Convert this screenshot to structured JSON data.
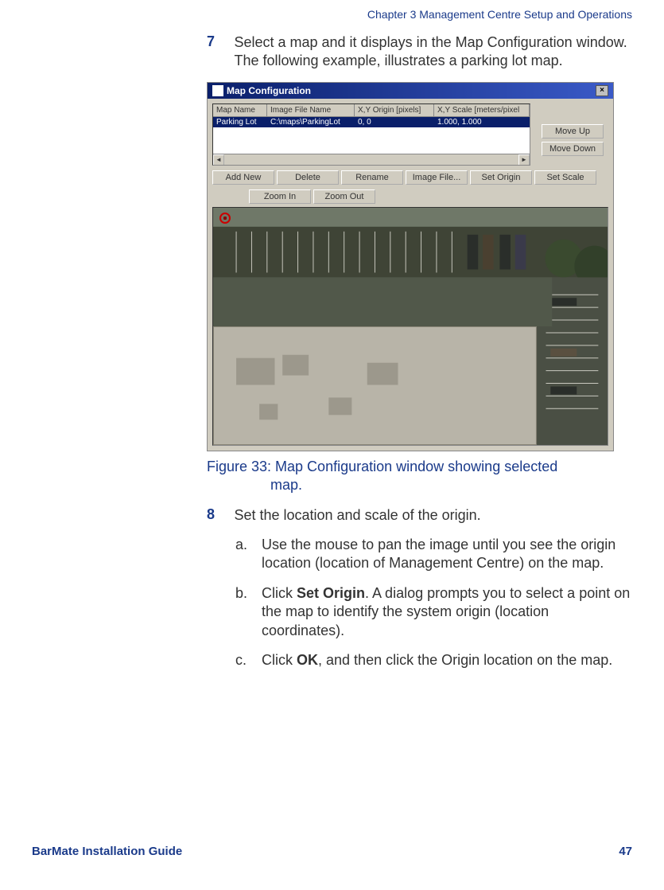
{
  "chapter_header": "Chapter 3 Management Centre Setup and Operations",
  "step7": {
    "num": "7",
    "text": "Select a map and it displays in the Map Configuration window. The following example, illustrates a parking lot map."
  },
  "screenshot": {
    "title": "Map Configuration",
    "close": "×",
    "headers": {
      "map_name": "Map Name",
      "image_file": "Image File Name",
      "origin": "X,Y Origin [pixels]",
      "scale": "X,Y Scale [meters/pixel"
    },
    "row": {
      "map_name": "Parking Lot",
      "image_file": "C:\\maps\\ParkingLot",
      "origin": "0, 0",
      "scale": "1.000, 1.000"
    },
    "buttons": {
      "move_up": "Move Up",
      "move_down": "Move Down",
      "add_new": "Add New",
      "delete": "Delete",
      "rename": "Rename",
      "image_file": "Image File...",
      "set_origin": "Set Origin",
      "set_scale": "Set Scale",
      "zoom_in": "Zoom In",
      "zoom_out": "Zoom Out"
    },
    "scroll_left": "◄",
    "scroll_right": "►"
  },
  "figure_caption_a": "Figure 33: Map Configuration window showing selected",
  "figure_caption_b": "map.",
  "step8": {
    "num": "8",
    "text": "Set the location and scale of the origin.",
    "a_marker": "a.",
    "a_text": "Use the mouse to pan the image until you see the origin location (location of Management Centre) on the map.",
    "b_marker": "b.",
    "b_text_pre": "Click ",
    "b_text_bold": "Set Origin",
    "b_text_post": ". A dialog prompts you to select a point on the map to identify the system origin (location coordinates).",
    "c_marker": "c.",
    "c_text_pre": "Click ",
    "c_text_bold": "OK",
    "c_text_post": ", and then click the Origin location on the map."
  },
  "footer_left": "BarMate Installation Guide",
  "footer_right": "47"
}
